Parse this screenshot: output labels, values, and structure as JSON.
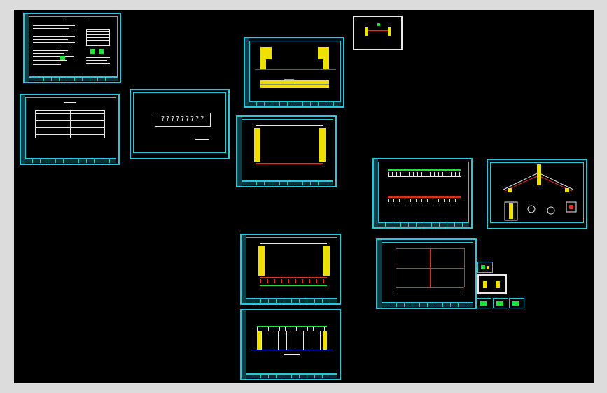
{
  "viewport": {
    "background": "#000000",
    "frame": "#dcdcdc",
    "accent": "#28c8dc"
  },
  "cover_sheet": {
    "title_text": "?????????"
  },
  "colors": {
    "frame": "#28c8dc",
    "yellow": "#f0e000",
    "red": "#e03020",
    "green": "#20e040",
    "blue": "#3050ff",
    "white": "#e8e8e8"
  }
}
